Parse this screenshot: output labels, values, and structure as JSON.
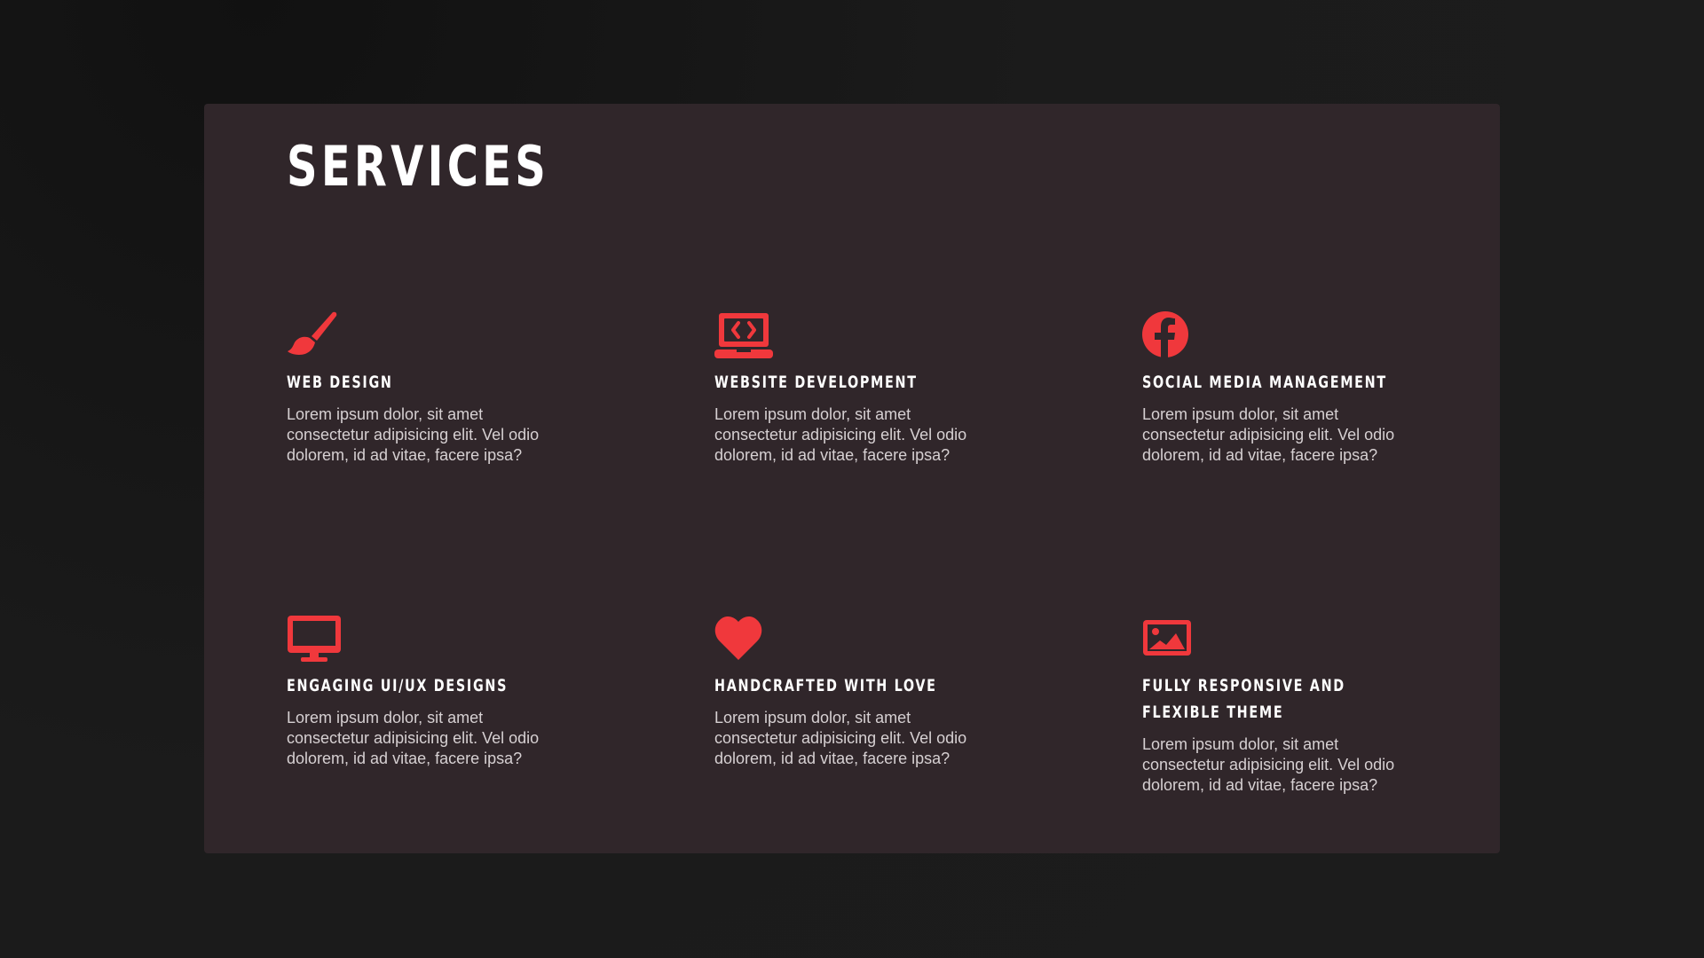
{
  "section": {
    "title": "SERVICES"
  },
  "accent_color": "#f0383c",
  "services": [
    {
      "icon": "paintbrush-icon",
      "title": "WEB DESIGN",
      "description": "Lorem ipsum dolor, sit amet consectetur adipisicing elit. Vel odio dolorem, id ad vitae, facere ipsa?"
    },
    {
      "icon": "laptop-code-icon",
      "title": "WEBSITE DEVELOPMENT",
      "description": "Lorem ipsum dolor, sit amet consectetur adipisicing elit. Vel odio dolorem, id ad vitae, facere ipsa?"
    },
    {
      "icon": "facebook-icon",
      "title": "SOCIAL MEDIA MANAGEMENT",
      "description": "Lorem ipsum dolor, sit amet consectetur adipisicing elit. Vel odio dolorem, id ad vitae, facere ipsa?"
    },
    {
      "icon": "desktop-monitor-icon",
      "title": "ENGAGING UI/UX DESIGNS",
      "description": "Lorem ipsum dolor, sit amet consectetur adipisicing elit. Vel odio dolorem, id ad vitae, facere ipsa?"
    },
    {
      "icon": "heart-icon",
      "title": "HANDCRAFTED WITH LOVE",
      "description": "Lorem ipsum dolor, sit amet consectetur adipisicing elit. Vel odio dolorem, id ad vitae, facere ipsa?"
    },
    {
      "icon": "image-icon",
      "title": "FULLY RESPONSIVE AND FLEXIBLE THEME",
      "description": "Lorem ipsum dolor, sit amet consectetur adipisicing elit. Vel odio dolorem, id ad vitae, facere ipsa?"
    }
  ]
}
